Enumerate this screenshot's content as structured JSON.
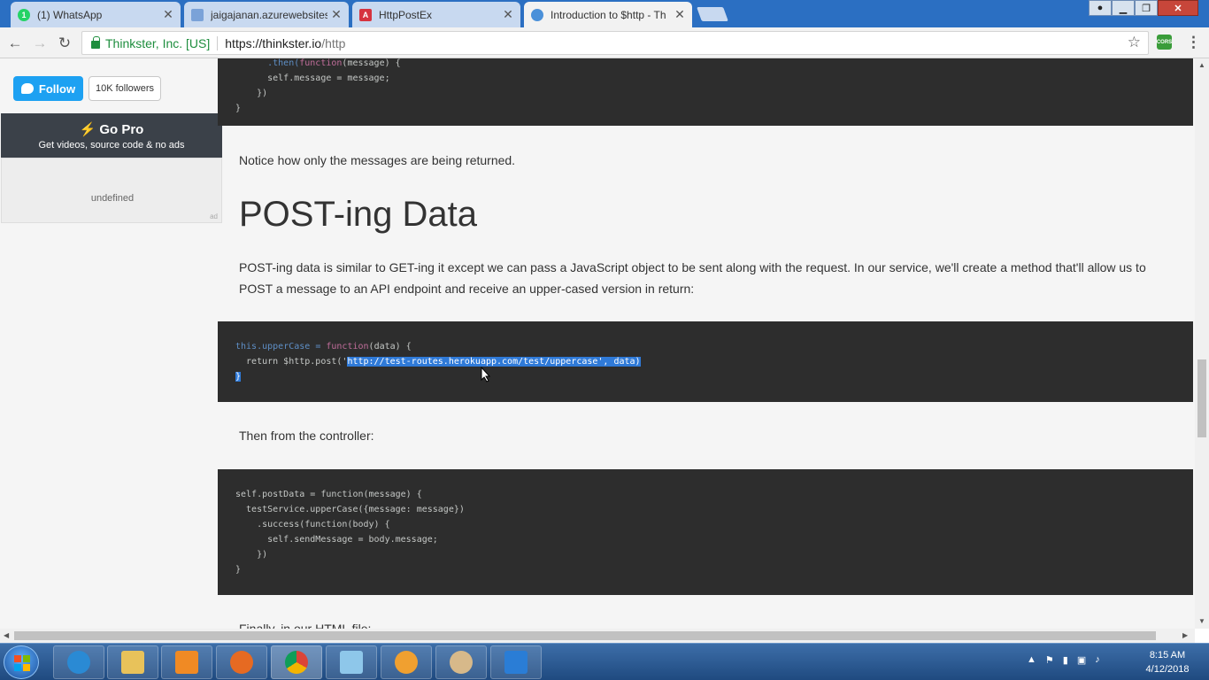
{
  "browser": {
    "tabs": [
      {
        "title": "(1) WhatsApp",
        "icon": "whatsapp-icon",
        "active": false
      },
      {
        "title": "jaigajanan.azurewebsites",
        "icon": "doc-icon",
        "active": false
      },
      {
        "title": "HttpPostEx",
        "icon": "angular-icon",
        "active": false
      },
      {
        "title": "Introduction to $http - Th",
        "icon": "thinkster-icon",
        "active": true
      }
    ],
    "close_glyph": "✕",
    "address": {
      "ev_name": "Thinkster, Inc. [US]",
      "url_scheme_host": "https://thinkster.io",
      "url_path": "/http"
    },
    "ext_label": "CORS"
  },
  "sidebar": {
    "follow_label": "Follow",
    "followers_label": "10K followers",
    "gopro_title": "Go Pro",
    "gopro_subtitle": "Get videos, source code & no ads",
    "ad_text": "undefined",
    "ad_mark": "ad"
  },
  "article": {
    "code1": [
      "      self.message = message;",
      "    })",
      "}"
    ],
    "para1": "Notice how only the messages are being returned.",
    "heading": "POST-ing Data",
    "para2_line1": "POST-ing data is similar to GET-ing it except we can pass a JavaScript object to be sent along with the request. In our service, we'll create a method that'll allow us to",
    "para2_line2": "POST a message to an API endpoint and receive an upper-cased version in return:",
    "code2": {
      "line1_a": "this",
      "line1_b": ".upperCase = ",
      "line1_c": "function",
      "line1_d": "(data) {",
      "line2_a": "  return $http.post('",
      "line2_sel": "http://test-routes.herokuapp.com/test/uppercase', data)",
      "line3_sel": "}"
    },
    "para3": "Then from the controller:",
    "code3": [
      "self.postData = function(message) {",
      "  testService.upperCase({message: message})",
      "    .success(function(body) {",
      "      self.sendMessage = body.message;",
      "    })",
      "}"
    ],
    "para4": "Finally, in our HTML file:"
  },
  "taskbar": {
    "apps": [
      "internet-explorer-icon",
      "file-explorer-icon",
      "media-player-icon",
      "firefox-icon",
      "chrome-icon",
      "notepad-icon",
      "app-icon",
      "paint-icon",
      "vscode-icon"
    ],
    "time": "8:15 AM",
    "date": "4/12/2018"
  },
  "colors": {
    "accent": "#2b6fc2",
    "twitter": "#1da1f2",
    "code_bg": "#2d2d2d",
    "selection": "#2f7ad8"
  }
}
